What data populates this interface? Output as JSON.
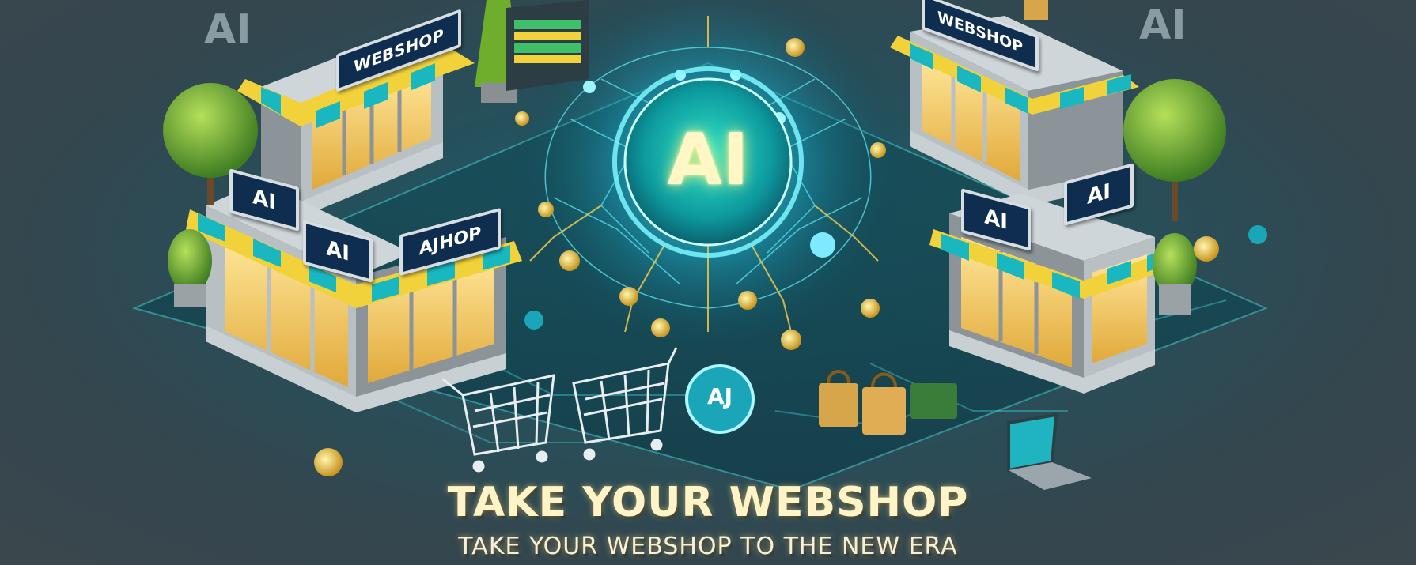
{
  "headline": "TAKE YOUR WEBSHOP",
  "subheadline": "TAKE YOUR WEBSHOP TO THE NEW ERA",
  "center_badge": "AI",
  "corner_marks": [
    "AI",
    "AI"
  ],
  "shop_signs": {
    "top_left": "WEBSHOP",
    "top_right": "WEBSHOP",
    "left_ai": "AI",
    "mid_ai": "AI",
    "ajhop": "AJHOP",
    "right_ai_1": "AI",
    "right_ai_2": "AI"
  },
  "bot_face_label": "AJ",
  "colors": {
    "accent_teal": "#19c3c8",
    "awning_yellow": "#f2d23a",
    "sign_navy": "#0e2d4f",
    "glow": "#fff27a"
  }
}
